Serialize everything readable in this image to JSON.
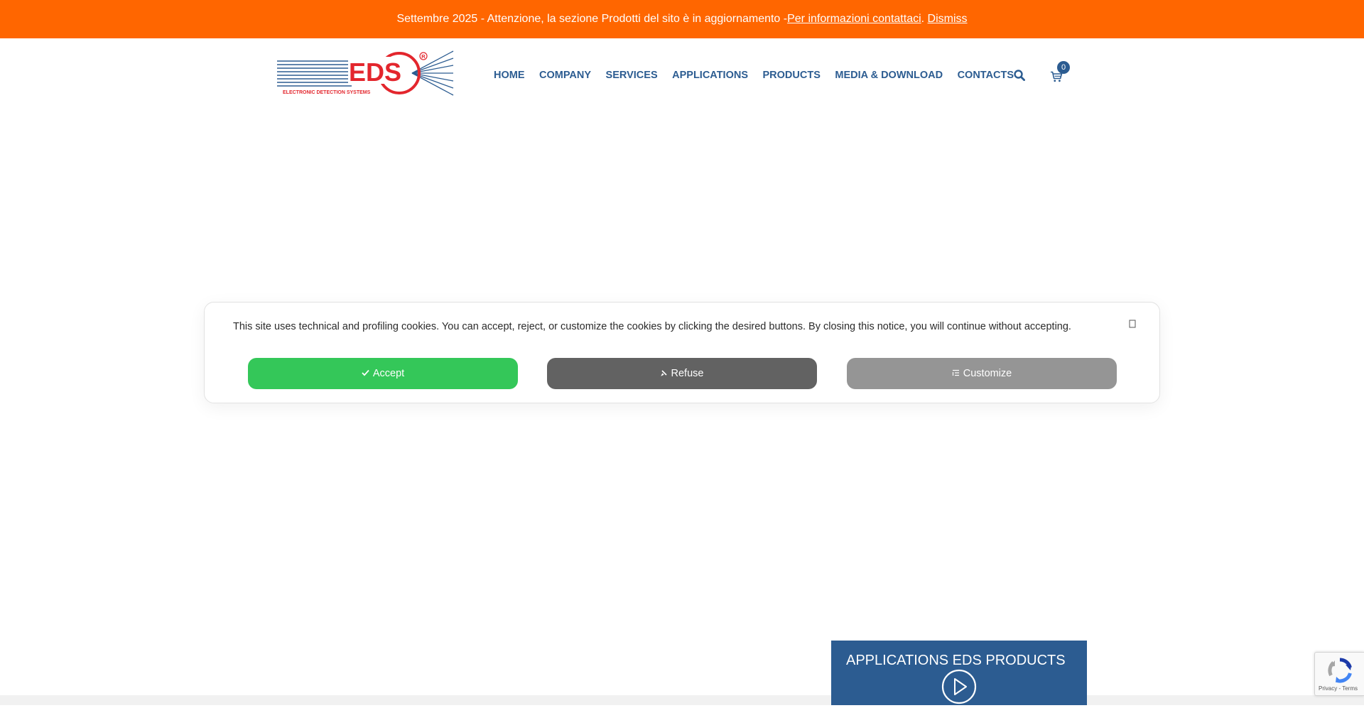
{
  "notice": {
    "text": "Settembre 2025 - Attenzione, la sezione Prodotti del sito è in aggiornamento - ",
    "link_label": "Per informazioni contattaci",
    "dot": ".",
    "dismiss_label": "Dismiss",
    "background": "#ff6600"
  },
  "header": {
    "logo_icon": "eds-logo",
    "logo": {
      "wordmark": "EDS",
      "tagline": "ELECTRONIC DETECTION SYSTEMS",
      "registered": "R"
    },
    "nav": [
      {
        "label": "HOME"
      },
      {
        "label": "COMPANY"
      },
      {
        "label": "SERVICES"
      },
      {
        "label": "APPLICATIONS"
      },
      {
        "label": "PRODUCTS"
      },
      {
        "label": "MEDIA & DOWNLOAD"
      },
      {
        "label": "CONTACTS"
      }
    ],
    "search_icon": "search-icon",
    "cart_icon": "cart-icon",
    "cart_count": "0",
    "accent": "#2c5c91"
  },
  "cookie_banner": {
    "text": "This site uses technical and profiling cookies. You can accept, reject, or customize the cookies by clicking the desired buttons. By closing this notice, you will continue without accepting.",
    "close_icon": "close-icon",
    "accept_label": "Accept",
    "refuse_label": "Refuse",
    "customize_label": "Customize",
    "accept_color": "#34c759",
    "refuse_color": "#626262",
    "customize_color": "#959595"
  },
  "promo": {
    "title": "APPLICATIONS EDS PRODUCTS",
    "play_icon": "play-circle-icon"
  },
  "recaptcha": {
    "privacy": "Privacy",
    "separator": " - ",
    "terms": "Terms"
  }
}
